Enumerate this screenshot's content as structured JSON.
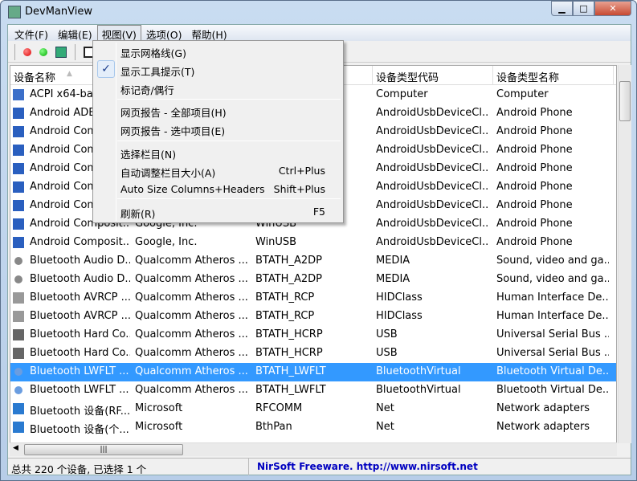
{
  "window": {
    "title": "DevManView"
  },
  "menubar": [
    "文件(F)",
    "编辑(E)",
    "视图(V)",
    "选项(O)",
    "帮助(H)"
  ],
  "view_menu": {
    "items": [
      {
        "label": "显示网格线(G)",
        "shortcut": "",
        "checked": false
      },
      {
        "label": "显示工具提示(T)",
        "shortcut": "",
        "checked": true
      },
      {
        "label": "标记奇/偶行",
        "shortcut": "",
        "checked": false
      },
      {
        "label": "网页报告 - 全部项目(H)",
        "shortcut": "",
        "checked": false
      },
      {
        "label": "网页报告 - 选中项目(E)",
        "shortcut": "",
        "checked": false
      },
      {
        "label": "选择栏目(N)",
        "shortcut": "",
        "checked": false
      },
      {
        "label": "自动调整栏目大小(A)",
        "shortcut": "Ctrl+Plus",
        "checked": false
      },
      {
        "label": "Auto Size Columns+Headers",
        "shortcut": "Shift+Plus",
        "checked": false
      },
      {
        "label": "刷新(R)",
        "shortcut": "F5",
        "checked": false
      }
    ],
    "check_mark": "✓"
  },
  "columns": [
    "设备名称",
    "",
    "",
    "设备类型代码",
    "设备类型名称"
  ],
  "rows": [
    [
      "ACPI x64-bas",
      "",
      "",
      "Computer",
      "Computer",
      "computer-icon"
    ],
    [
      "Android ADB",
      "",
      "",
      "AndroidUsbDeviceCl...",
      "Android Phone",
      "device-icon"
    ],
    [
      "Android Com",
      "",
      "",
      "AndroidUsbDeviceCl...",
      "Android Phone",
      "device-icon"
    ],
    [
      "Android Com",
      "",
      "",
      "AndroidUsbDeviceCl...",
      "Android Phone",
      "device-icon"
    ],
    [
      "Android Com",
      "",
      "",
      "AndroidUsbDeviceCl...",
      "Android Phone",
      "device-icon"
    ],
    [
      "Android Com",
      "",
      "",
      "AndroidUsbDeviceCl...",
      "Android Phone",
      "device-icon"
    ],
    [
      "Android Com",
      "",
      "",
      "AndroidUsbDeviceCl...",
      "Android Phone",
      "device-icon"
    ],
    [
      "Android Composit...",
      "Google, Inc.",
      "WinUSB",
      "AndroidUsbDeviceCl...",
      "Android Phone",
      "device-icon"
    ],
    [
      "Android Composit...",
      "Google, Inc.",
      "WinUSB",
      "AndroidUsbDeviceCl...",
      "Android Phone",
      "device-icon"
    ],
    [
      "Bluetooth Audio D...",
      "Qualcomm Atheros ...",
      "BTATH_A2DP",
      "MEDIA",
      "Sound, video and ga...",
      "speaker-icon"
    ],
    [
      "Bluetooth Audio D...",
      "Qualcomm Atheros ...",
      "BTATH_A2DP",
      "MEDIA",
      "Sound, video and ga...",
      "speaker-icon"
    ],
    [
      "Bluetooth AVRCP ...",
      "Qualcomm Atheros ...",
      "BTATH_RCP",
      "HIDClass",
      "Human Interface De...",
      "hid-icon"
    ],
    [
      "Bluetooth AVRCP ...",
      "Qualcomm Atheros ...",
      "BTATH_RCP",
      "HIDClass",
      "Human Interface De...",
      "hid-icon"
    ],
    [
      "Bluetooth Hard Co...",
      "Qualcomm Atheros ...",
      "BTATH_HCRP",
      "USB",
      "Universal Serial Bus ...",
      "usb-icon"
    ],
    [
      "Bluetooth Hard Co...",
      "Qualcomm Atheros ...",
      "BTATH_HCRP",
      "USB",
      "Universal Serial Bus ...",
      "usb-icon"
    ],
    [
      "Bluetooth LWFLT ...",
      "Qualcomm Atheros ...",
      "BTATH_LWFLT",
      "BluetoothVirtual",
      "Bluetooth Virtual De...",
      "bluetooth-icon"
    ],
    [
      "Bluetooth LWFLT ...",
      "Qualcomm Atheros ...",
      "BTATH_LWFLT",
      "BluetoothVirtual",
      "Bluetooth Virtual De...",
      "bluetooth-icon"
    ],
    [
      "Bluetooth 设备(RF...",
      "Microsoft",
      "RFCOMM",
      "Net",
      "Network adapters",
      "network-icon"
    ],
    [
      "Bluetooth 设备(个...",
      "Microsoft",
      "BthPan",
      "Net",
      "Network adapters",
      "network-icon"
    ]
  ],
  "selected_row": 15,
  "status": {
    "left": "总共 220 个设备, 已选择 1 个",
    "right": "NirSoft Freeware.  http://www.nirsoft.net"
  },
  "colors": {
    "selection": "#3399ff",
    "link": "#0000c0"
  }
}
